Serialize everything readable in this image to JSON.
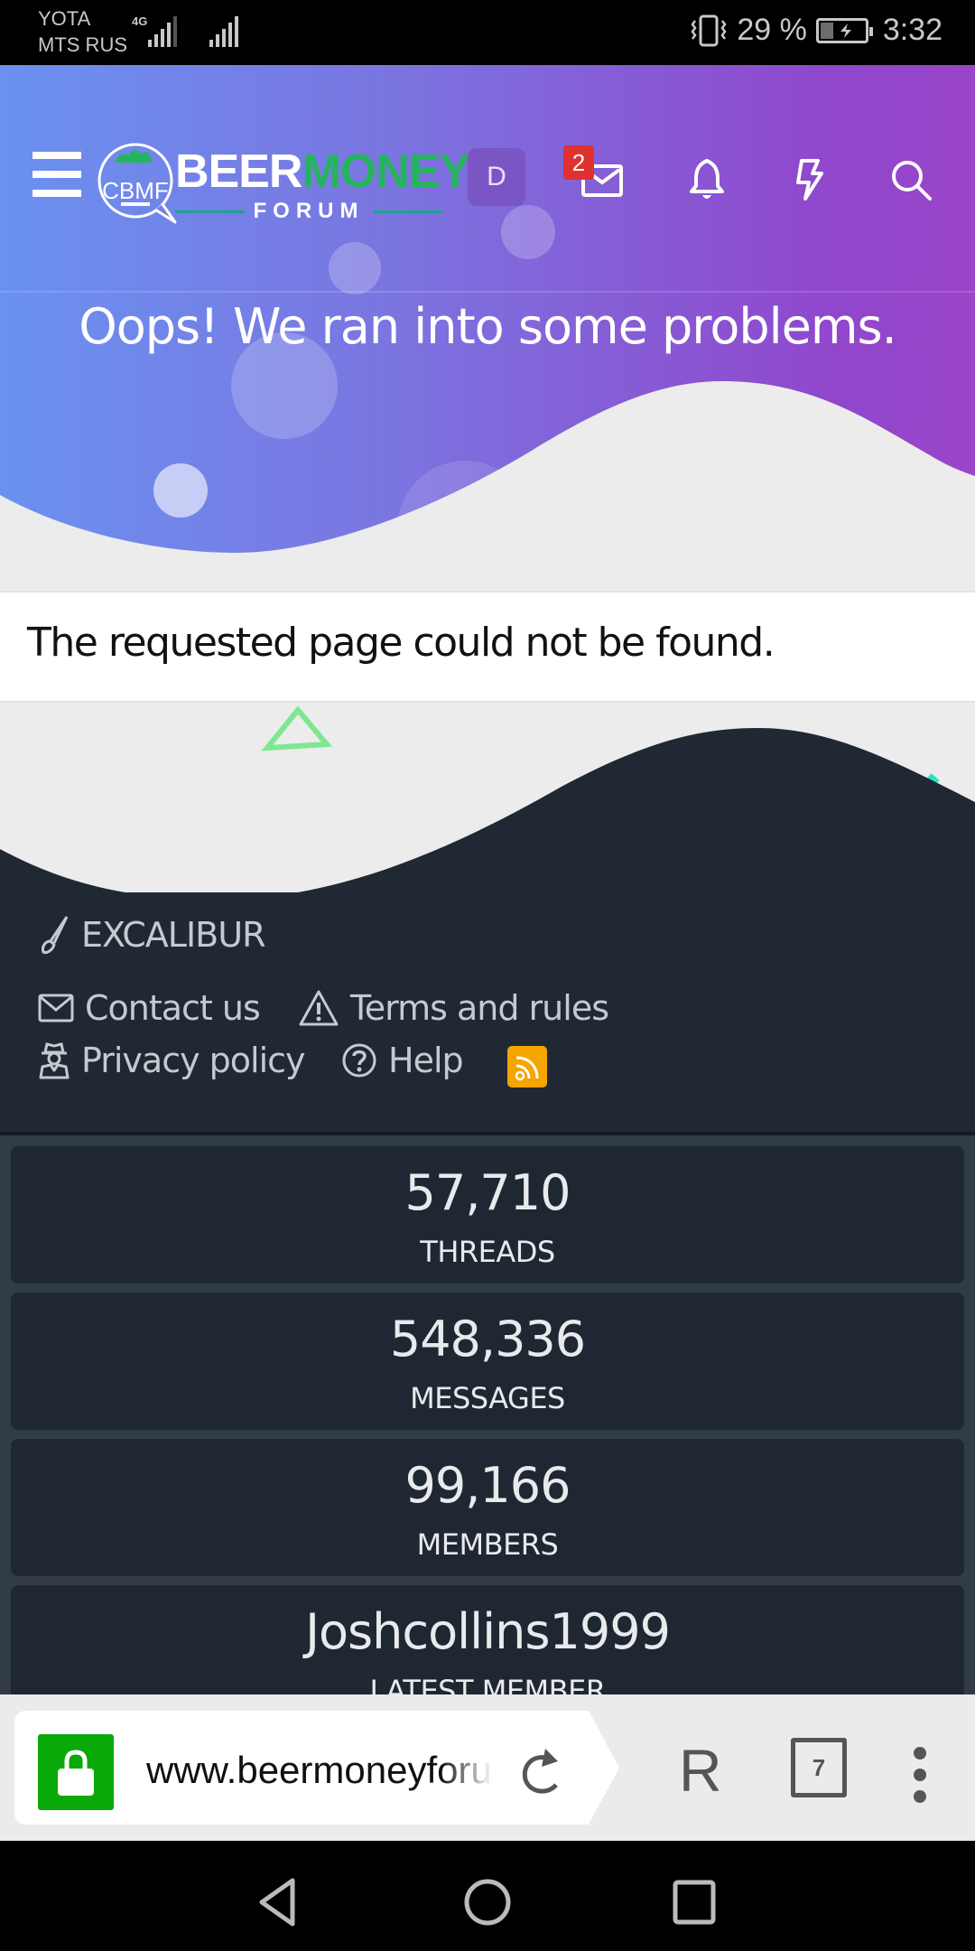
{
  "status_bar": {
    "carrier_1": "YOTA",
    "carrier_2": "MTS RUS",
    "network_type": "4G",
    "battery_percent": "29 %",
    "battery_level": 0.29,
    "time": "3:32"
  },
  "header": {
    "logo_word_1": "BEER",
    "logo_word_2": "MONEY",
    "logo_sub": "FORUM",
    "logo_badge": "CBMF",
    "avatar_letter": "D",
    "inbox_badge_count": "2",
    "icons": [
      "menu-icon",
      "inbox-icon",
      "bell-icon",
      "bolt-icon",
      "search-icon"
    ],
    "colors": {
      "gradient_start": "#6a91f0",
      "gradient_end": "#9a45c8",
      "logo_green": "#25b45e",
      "badge_red": "#e03131"
    }
  },
  "page": {
    "title": "Oops! We ran into some problems.",
    "message": "The requested page could not be found."
  },
  "footer": {
    "style_chooser": "EXCALIBUR",
    "links": [
      {
        "label": "Contact us",
        "icon": "envelope-icon"
      },
      {
        "label": "Terms and rules",
        "icon": "warning-icon"
      },
      {
        "label": "Privacy policy",
        "icon": "user-secret-icon"
      },
      {
        "label": "Help",
        "icon": "question-circle-icon"
      }
    ],
    "rss_icon": "rss-icon",
    "rss_color": "#f5a400"
  },
  "stats": [
    {
      "value": "57,710",
      "label": "THREADS"
    },
    {
      "value": "548,336",
      "label": "MESSAGES"
    },
    {
      "value": "99,166",
      "label": "MEMBERS"
    },
    {
      "value": "Joshcollins1999",
      "label": "LATEST MEMBER"
    }
  ],
  "browser": {
    "url": "www.beermoneyforum.com",
    "yandex_label": "Я",
    "tab_count": "7",
    "secure_color": "#0aa90a"
  }
}
